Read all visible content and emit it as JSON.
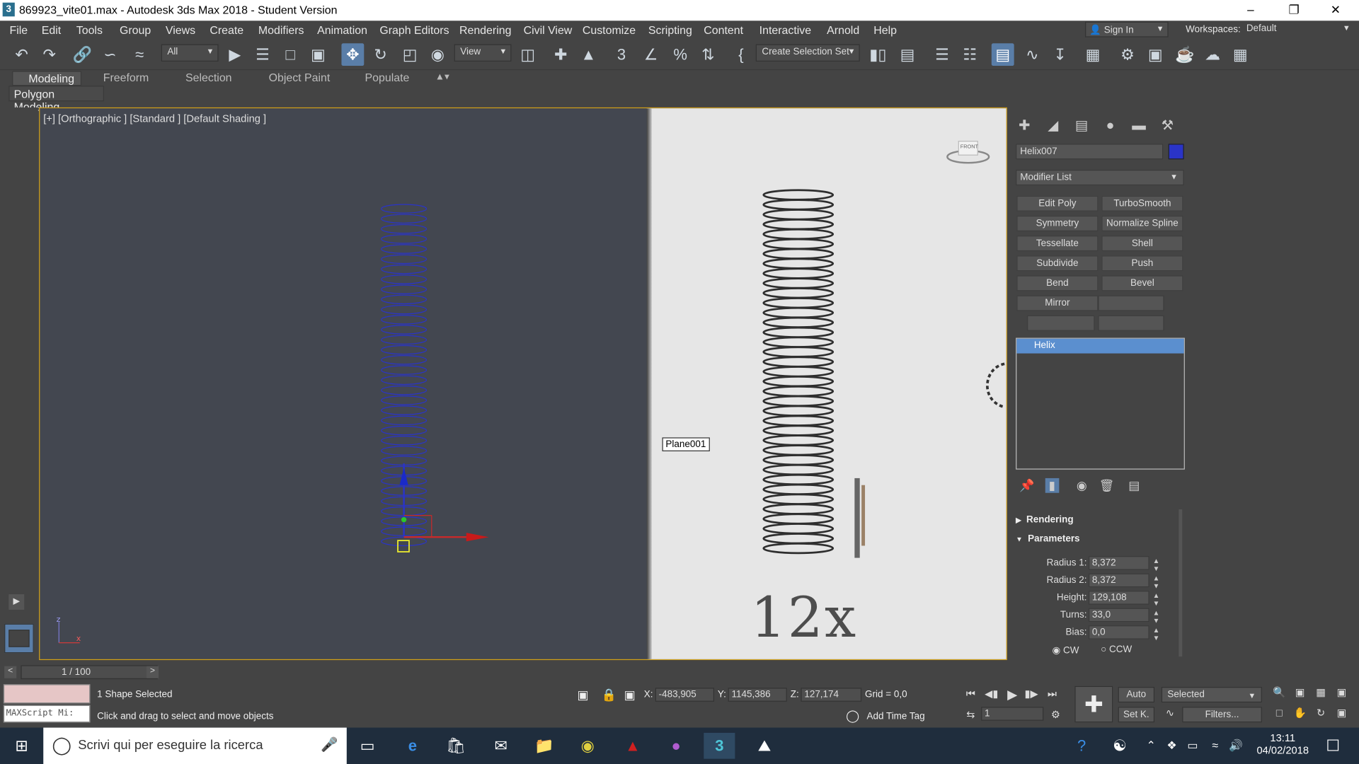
{
  "window": {
    "title": "869923_vite01.max - Autodesk 3ds Max 2018 - Student Version",
    "app_icon": "3"
  },
  "menu": [
    "File",
    "Edit",
    "Tools",
    "Group",
    "Views",
    "Create",
    "Modifiers",
    "Animation",
    "Graph Editors",
    "Rendering",
    "Civil View",
    "Customize",
    "Scripting",
    "Content",
    "Interactive",
    "Arnold",
    "Help"
  ],
  "account": {
    "sign_in": "Sign In",
    "workspaces_label": "Workspaces:",
    "workspace_value": "Default"
  },
  "toolbar": {
    "filter_value": "All",
    "view_value": "View",
    "selection_set": "Create Selection Set"
  },
  "ribbon": {
    "tabs": [
      "Modeling",
      "Freeform",
      "Selection",
      "Object Paint",
      "Populate"
    ],
    "sub": "Polygon Modeling"
  },
  "viewport": {
    "label": "[+] [Orthographic ] [Standard ] [Default Shading ]",
    "plane_label": "Plane001",
    "ref_text": "12x",
    "cube_label": "FRONT"
  },
  "command_panel": {
    "object_name": "Helix007",
    "object_color": "#2a34c8",
    "modifier_list": "Modifier List",
    "buttons": [
      [
        "Edit Poly",
        "TurboSmooth"
      ],
      [
        "Symmetry",
        "Normalize Spline"
      ],
      [
        "Tessellate",
        "Shell"
      ],
      [
        "Subdivide",
        "Push"
      ],
      [
        "Bend",
        "Bevel"
      ],
      [
        "Mirror",
        ""
      ],
      [
        "",
        ""
      ]
    ],
    "stack_item": "Helix",
    "rollouts": {
      "rendering": "Rendering",
      "parameters": "Parameters"
    },
    "params": [
      {
        "label": "Radius 1:",
        "value": "8,372"
      },
      {
        "label": "Radius 2:",
        "value": "8,372"
      },
      {
        "label": "Height:",
        "value": "129,108"
      },
      {
        "label": "Turns:",
        "value": "33,0"
      },
      {
        "label": "Bias:",
        "value": "0,0"
      }
    ],
    "cw": "CW",
    "ccw": "CCW"
  },
  "timeline": {
    "frame": "1 / 100",
    "prev": "<",
    "next": ">"
  },
  "status": {
    "selection": "1 Shape Selected",
    "prompt": "Click and drag to select and move objects",
    "maxscript": "MAXScript Mi:",
    "x_label": "X:",
    "x": "-483,905",
    "y_label": "Y:",
    "y": "1145,386",
    "z_label": "Z:",
    "z": "127,174",
    "grid": "Grid = 0,0",
    "add_time_tag": "Add Time Tag",
    "auto": "Auto",
    "set_key": "Set K.",
    "selected": "Selected",
    "filters": "Filters...",
    "frame_field": "1"
  },
  "taskbar": {
    "search": "Scrivi qui per eseguire la ricerca",
    "time": "13:11",
    "date": "04/02/2018"
  }
}
